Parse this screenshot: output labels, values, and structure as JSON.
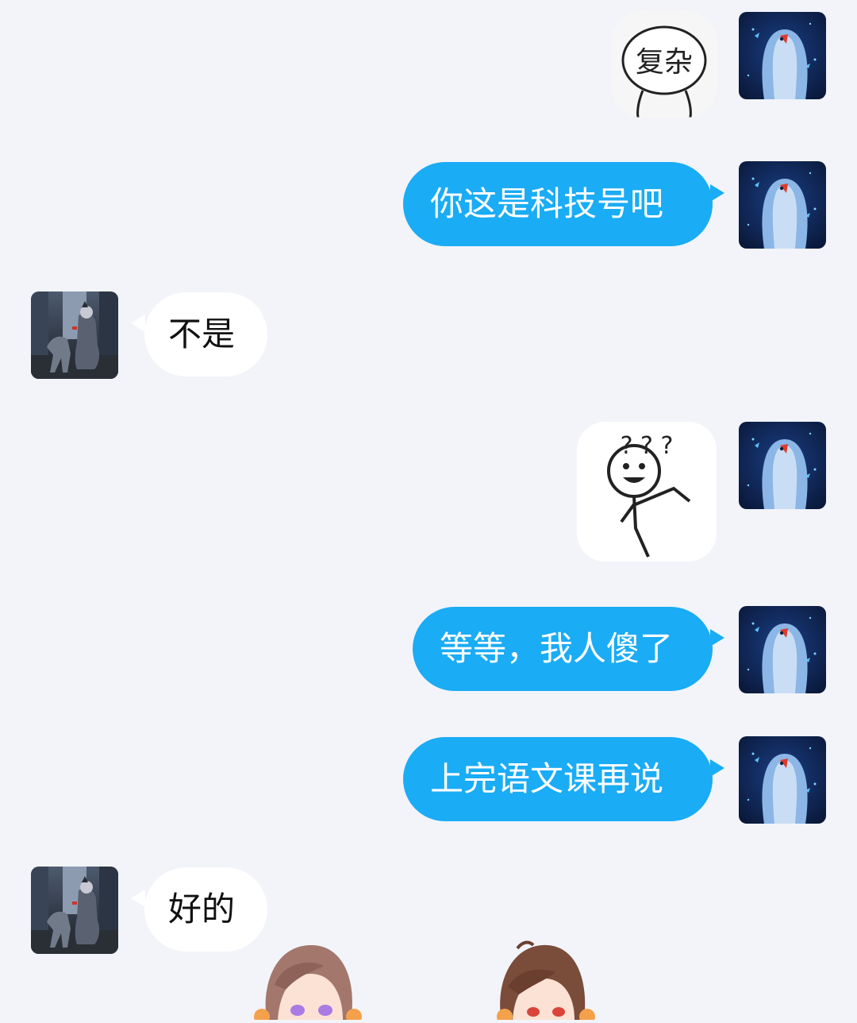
{
  "messages": [
    {
      "sender": "me",
      "kind": "sticker",
      "sticker_text": "复杂"
    },
    {
      "sender": "me",
      "kind": "text",
      "text": "你这是科技号吧"
    },
    {
      "sender": "other",
      "kind": "text",
      "text": "不是"
    },
    {
      "sender": "me",
      "kind": "sticker",
      "sticker_text": "? ? ?"
    },
    {
      "sender": "me",
      "kind": "text",
      "text": "等等，我人傻了"
    },
    {
      "sender": "me",
      "kind": "text",
      "text": "上完语文课再说"
    },
    {
      "sender": "other",
      "kind": "text",
      "text": "好的"
    }
  ],
  "colors": {
    "background": "#f2f4f9",
    "outgoing_bubble": "#1aacf5",
    "incoming_bubble": "#ffffff",
    "outgoing_text": "#ffffff",
    "incoming_text": "#111111"
  },
  "icons": {
    "my_avatar": "penguin-avatar",
    "other_avatar": "dark-alley-avatar",
    "bottom_decor": "anime-characters-decor"
  }
}
